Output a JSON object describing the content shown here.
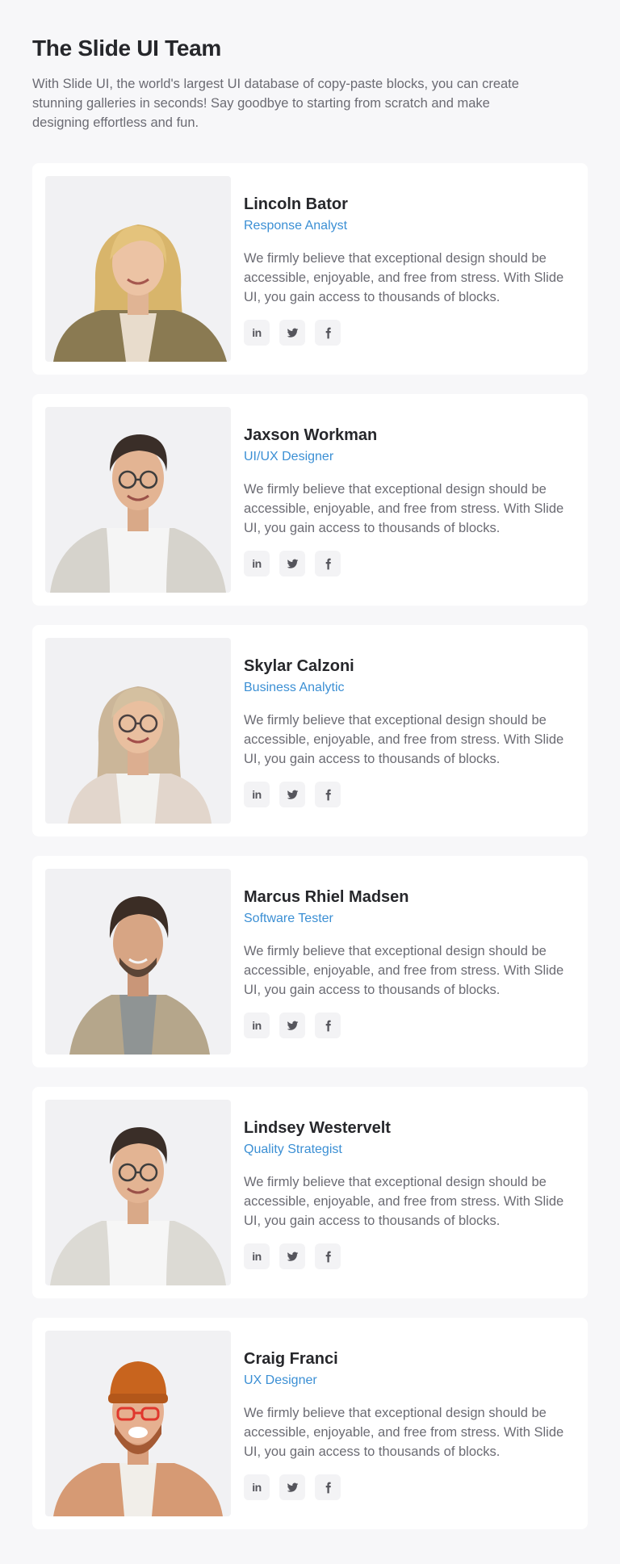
{
  "header": {
    "title": "The Slide UI Team",
    "intro": "With Slide UI, the world's largest UI database of copy-paste blocks, you can create stunning galleries in seconds! Say goodbye to starting from scratch and make designing effortless and fun."
  },
  "colors": {
    "accent": "#3b8fd4",
    "background": "#f7f7f9",
    "card": "#ffffff"
  },
  "social_icons": [
    "linkedin-icon",
    "twitter-icon",
    "facebook-icon"
  ],
  "members": [
    {
      "name": "Lincoln Bator",
      "role": "Response Analyst",
      "bio": "We firmly believe that exceptional design should be accessible, enjoyable, and free from stress. With Slide UI, you gain access to thousands of blocks."
    },
    {
      "name": "Jaxson Workman",
      "role": "UI/UX Designer",
      "bio": "We firmly believe that exceptional design should be accessible, enjoyable, and free from stress. With Slide UI, you gain access to thousands of blocks."
    },
    {
      "name": "Skylar Calzoni",
      "role": "Business Analytic",
      "bio": "We firmly believe that exceptional design should be accessible, enjoyable, and free from stress. With Slide UI, you gain access to thousands of blocks."
    },
    {
      "name": "Marcus Rhiel Madsen",
      "role": "Software Tester",
      "bio": "We firmly believe that exceptional design should be accessible, enjoyable, and free from stress. With Slide UI, you gain access to thousands of blocks."
    },
    {
      "name": "Lindsey Westervelt",
      "role": "Quality Strategist",
      "bio": "We firmly believe that exceptional design should be accessible, enjoyable, and free from stress. With Slide UI, you gain access to thousands of blocks."
    },
    {
      "name": "Craig Franci",
      "role": "UX Designer",
      "bio": "We firmly believe that exceptional design should be accessible, enjoyable, and free from stress. With Slide UI, you gain access to thousands of blocks."
    }
  ]
}
